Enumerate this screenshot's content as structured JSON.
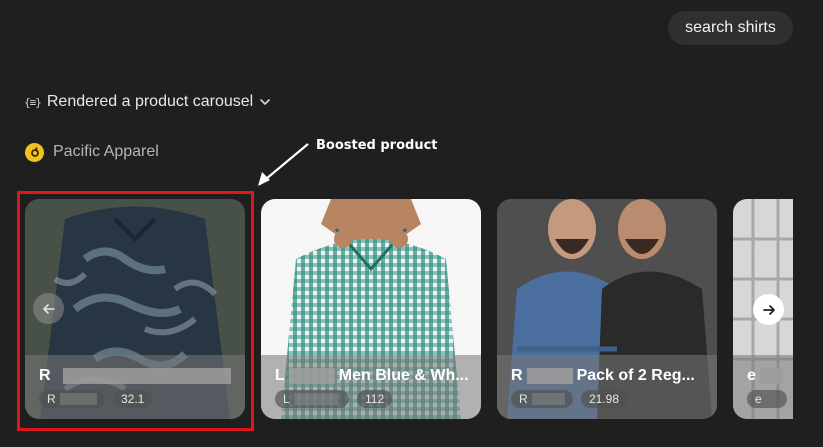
{
  "header": {
    "search_pill": "search shirts"
  },
  "tool": {
    "label": "Rendered a product carousel"
  },
  "merchant": {
    "name": "Pacific Apparel"
  },
  "annotation": {
    "text": "Boosted product"
  },
  "colors": {
    "background": "#1f1f1f",
    "highlight": "#e0161b",
    "merchant_logo": "#f4c21c"
  },
  "products": [
    {
      "title_prefix": "R",
      "title_suffix": "",
      "price_prefix": "R",
      "price": "32.1"
    },
    {
      "title_prefix": "L",
      "title_suffix": "Men Blue & Wh...",
      "price_prefix": "L",
      "price": "112"
    },
    {
      "title_prefix": "R",
      "title_suffix": "Pack of 2 Reg...",
      "price_prefix": "R",
      "price": "21.98"
    },
    {
      "title_prefix": "e",
      "title_suffix": "",
      "price_prefix": "e",
      "price": ""
    }
  ],
  "carousel": {
    "prev_icon": "arrow-left-icon",
    "next_icon": "arrow-right-icon"
  }
}
